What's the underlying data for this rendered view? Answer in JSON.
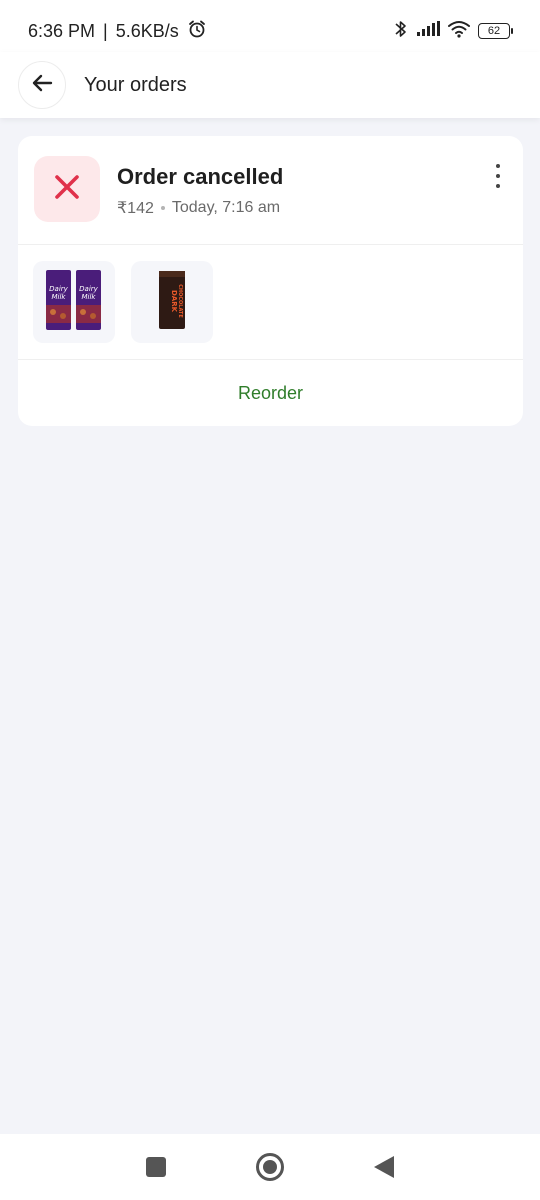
{
  "status_bar": {
    "time": "6:36 PM",
    "separator": "|",
    "network_speed": "5.6KB/s",
    "battery_level": "62",
    "icons": [
      "alarm-icon",
      "bluetooth-icon",
      "signal-icon",
      "wifi-icon",
      "battery-icon"
    ]
  },
  "header": {
    "title": "Your orders",
    "back_icon": "arrow-left-icon"
  },
  "order": {
    "status": "Order cancelled",
    "amount": "₹142",
    "date": "Today, 7:16 am",
    "status_icon": "close-icon",
    "status_color": "#e0314b",
    "items": [
      {
        "name": "Dairy Milk",
        "icon": "dairy-milk-chocolate-image"
      },
      {
        "name": "Dark Chocolate",
        "icon": "dark-chocolate-image"
      }
    ],
    "reorder_label": "Reorder",
    "reorder_color": "#2f7d2a"
  },
  "nav_bar": {
    "icons": [
      "recents-icon",
      "home-icon",
      "back-icon"
    ]
  }
}
